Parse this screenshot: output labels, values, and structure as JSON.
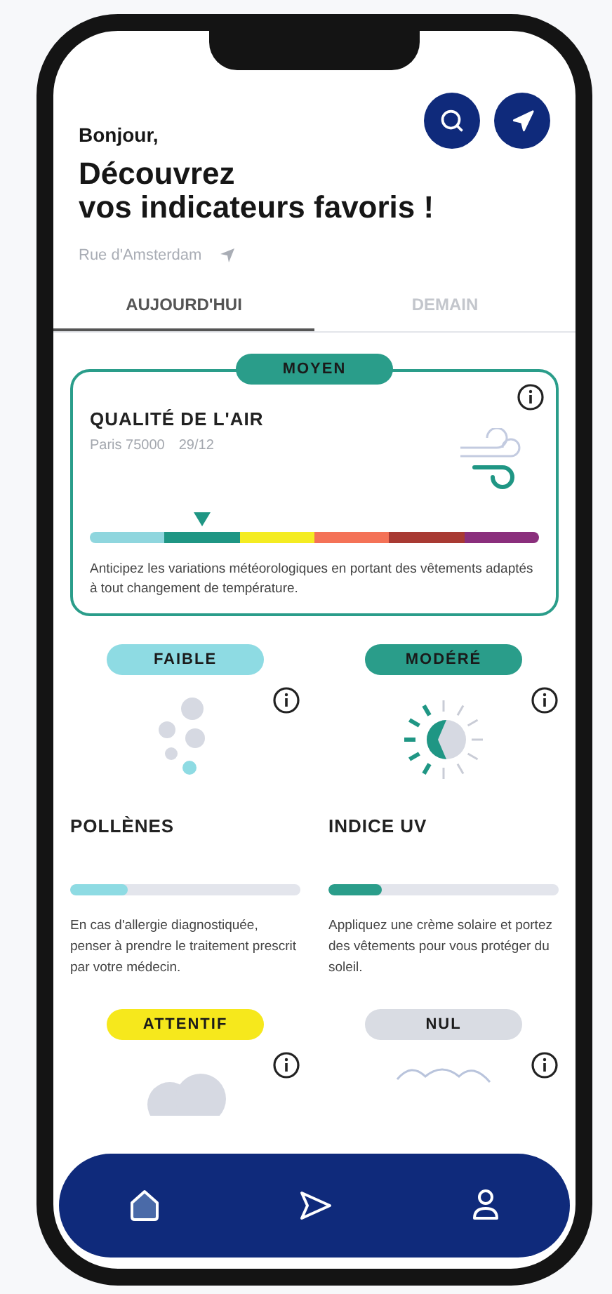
{
  "header": {
    "greeting": "Bonjour,",
    "title_lines": [
      "Découvrez",
      "vos indicateurs favoris !"
    ],
    "location": "Rue d'Amsterdam"
  },
  "tabs": [
    {
      "label": "AUJOURD'HUI",
      "selected": true
    },
    {
      "label": "DEMAIN",
      "selected": false
    }
  ],
  "air_quality": {
    "badge": {
      "label": "MOYEN",
      "color": "#2a9d8a"
    },
    "title": "QUALITÉ DE L'AIR",
    "place": "Paris 75000",
    "date": "29/12",
    "level": 0.25,
    "scale": [
      {
        "color": "#8fd6de"
      },
      {
        "color": "#1f9684"
      },
      {
        "color": "#f4ec22"
      },
      {
        "color": "#f47257"
      },
      {
        "color": "#a83a33"
      },
      {
        "color": "#8a2f7c"
      }
    ],
    "description": "Anticipez les variations météorologiques en portant des vêtements adaptés à tout changement de température."
  },
  "indicators": [
    {
      "kind": "pollen",
      "badge": {
        "label": "FAIBLE",
        "color": "#8edbe3"
      },
      "title": "POLLÈNES",
      "level": 0.25,
      "description": "En cas d'allergie diagnostiquée, penser à prendre le traitement prescrit par votre médecin."
    },
    {
      "kind": "uv",
      "badge": {
        "label": "MODÉRÉ",
        "color": "#2a9d8a"
      },
      "title": "INDICE UV",
      "level": 0.23,
      "description": "Appliquez une crème solaire et portez des vêtements pour vous protéger du soleil."
    },
    {
      "kind": "cloud",
      "badge": {
        "label": "ATTENTIF",
        "color": "#f6e81c"
      }
    },
    {
      "kind": "waves",
      "badge": {
        "label": "NUL",
        "color": "#d9dce3"
      }
    }
  ],
  "nav": [
    {
      "kind": "home",
      "selected": true
    },
    {
      "kind": "send",
      "selected": false
    },
    {
      "kind": "user",
      "selected": false
    }
  ]
}
